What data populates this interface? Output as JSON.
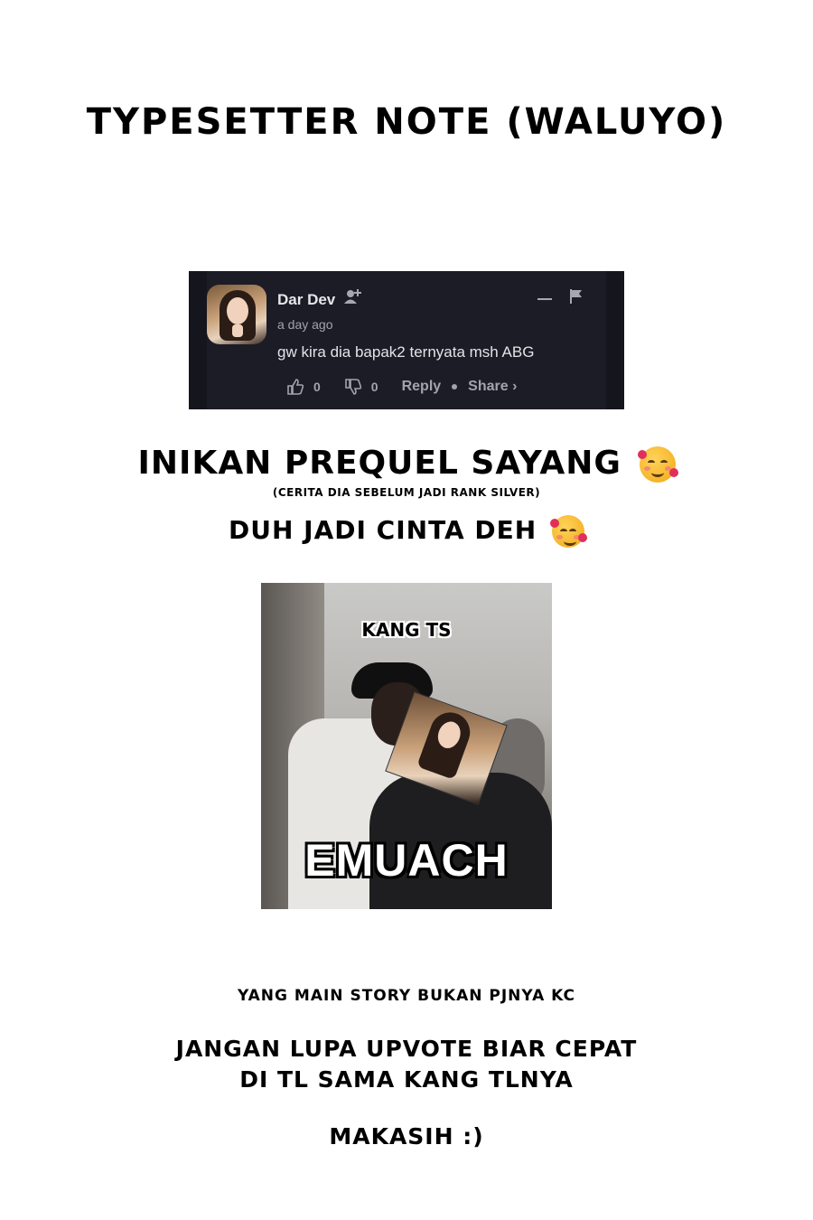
{
  "title": "TYPESETTER NOTE (WALUYO)",
  "comment": {
    "author": "Dar Dev",
    "time": "a day ago",
    "text": "gw kira dia bapak2 ternyata msh ABG",
    "likes": "0",
    "dislikes": "0",
    "reply_label": "Reply",
    "share_label": "Share ›",
    "accent_bg": "#1c1c26"
  },
  "headline": "INIKAN PREQUEL SAYANG",
  "subnote": "(CERITA DIA SEBELUM JADI RANK SILVER)",
  "line2": "DUH JADI CINTA DEH",
  "meme": {
    "tag": "KANG TS",
    "caption": "EMUACH"
  },
  "footer": {
    "line1": "YANG MAIN STORY BUKAN PJNYA KC",
    "line2a": "JANGAN LUPA UPVOTE BIAR CEPAT",
    "line2b": "DI TL SAMA KANG TLNYA",
    "line3": "MAKASIH :)"
  },
  "icons": [
    "follow-icon",
    "minimize-icon",
    "flag-icon",
    "thumbs-up-icon",
    "thumbs-down-icon",
    "smiling-hearts-emoji"
  ]
}
